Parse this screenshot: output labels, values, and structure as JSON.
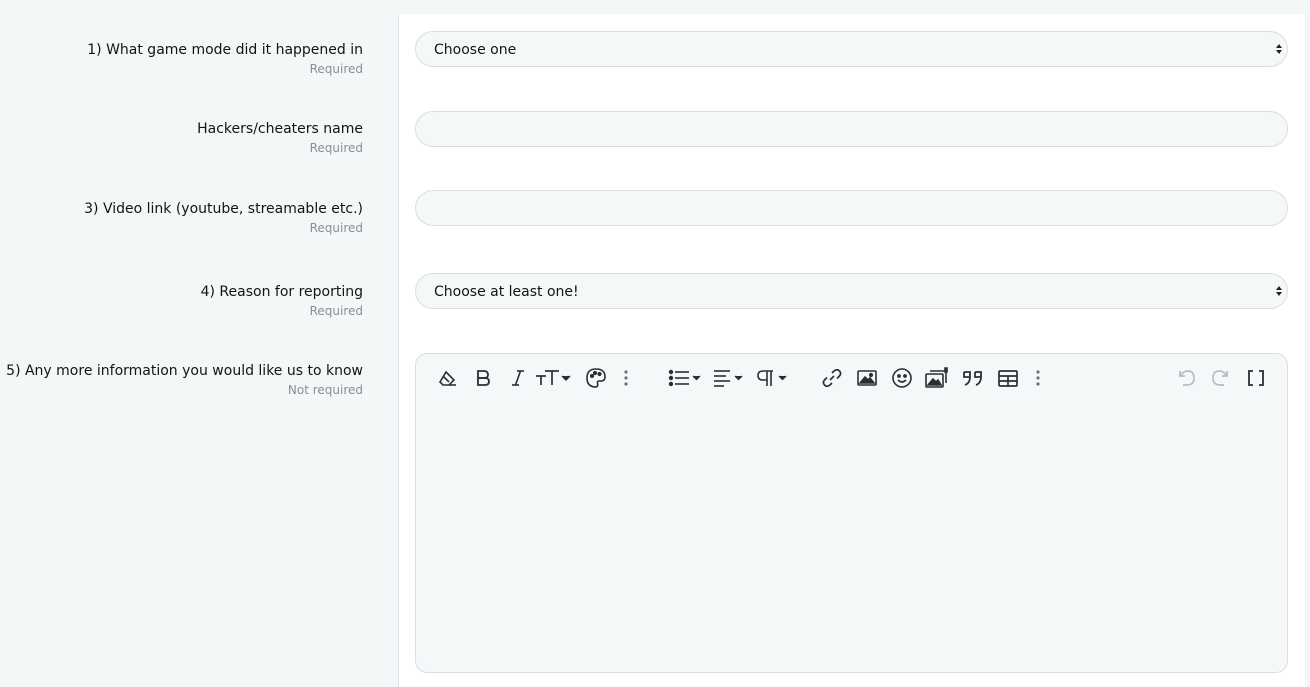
{
  "fields": [
    {
      "label": "1) What game mode did it happened in",
      "hint": "Required",
      "type": "select",
      "value": "Choose one"
    },
    {
      "label": "Hackers/cheaters name",
      "hint": "Required",
      "type": "text",
      "value": ""
    },
    {
      "label": "3) Video link (youtube, streamable etc.)",
      "hint": "Required",
      "type": "text",
      "value": ""
    },
    {
      "label": "4) Reason for reporting",
      "hint": "Required",
      "type": "select",
      "value": "Choose at least one!"
    },
    {
      "label": "5) Any more information you would like us to know",
      "hint": "Not required",
      "type": "editor",
      "value": ""
    }
  ],
  "editor_toolbar": {
    "left_group": [
      "eraser-icon",
      "bold-icon",
      "italic-icon",
      "text-size-icon",
      "palette-icon",
      "more-vertical-icon"
    ],
    "middle_group": [
      "list-icon",
      "align-icon",
      "paragraph-icon"
    ],
    "insert_group": [
      "link-icon",
      "image-icon",
      "smiley-icon",
      "media-icon",
      "quote-icon",
      "table-icon",
      "more-vertical-icon"
    ],
    "right_group": [
      "undo-icon",
      "redo-icon",
      "bbcode-toggle-icon"
    ]
  },
  "colors": {
    "accent_bg": "#f4f7f8",
    "input_bg": "#f5f8f9",
    "border": "#d8dfe2",
    "hint": "#8a8f93",
    "icon": "#2b2f33",
    "icon_disabled": "#b6bcc0"
  }
}
